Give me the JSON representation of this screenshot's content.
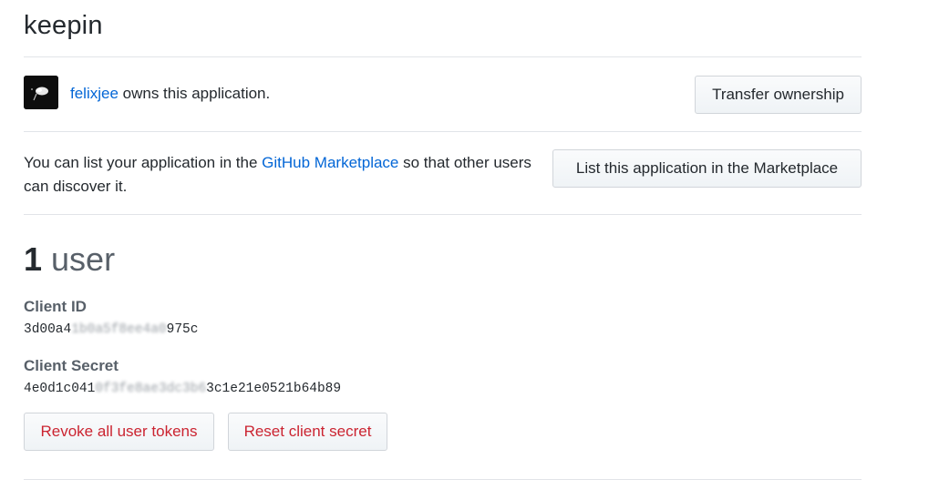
{
  "app": {
    "title": "keepin"
  },
  "owner": {
    "username": "felixjee",
    "suffix": " owns this application.",
    "transfer_button": "Transfer ownership"
  },
  "marketplace": {
    "text_before": "You can list your application in the ",
    "link_text": "GitHub Marketplace",
    "text_after": " so that other users can discover it.",
    "button": "List this application in the Marketplace"
  },
  "users": {
    "count": "1",
    "unit": "user"
  },
  "credentials": {
    "client_id_label": "Client ID",
    "client_id_prefix": "3d00a4",
    "client_id_hidden": "1b0a5f8ee4a0",
    "client_id_suffix": "975c",
    "client_secret_label": "Client Secret",
    "client_secret_prefix": "4e0d1c041",
    "client_secret_hidden": "0f3fe8ae3dc3b6",
    "client_secret_suffix": "3c1e21e0521b64b89"
  },
  "actions": {
    "revoke_button": "Revoke all user tokens",
    "reset_button": "Reset client secret"
  },
  "colors": {
    "link": "#0366d6",
    "danger": "#cb2431",
    "border": "#e1e4e8"
  }
}
